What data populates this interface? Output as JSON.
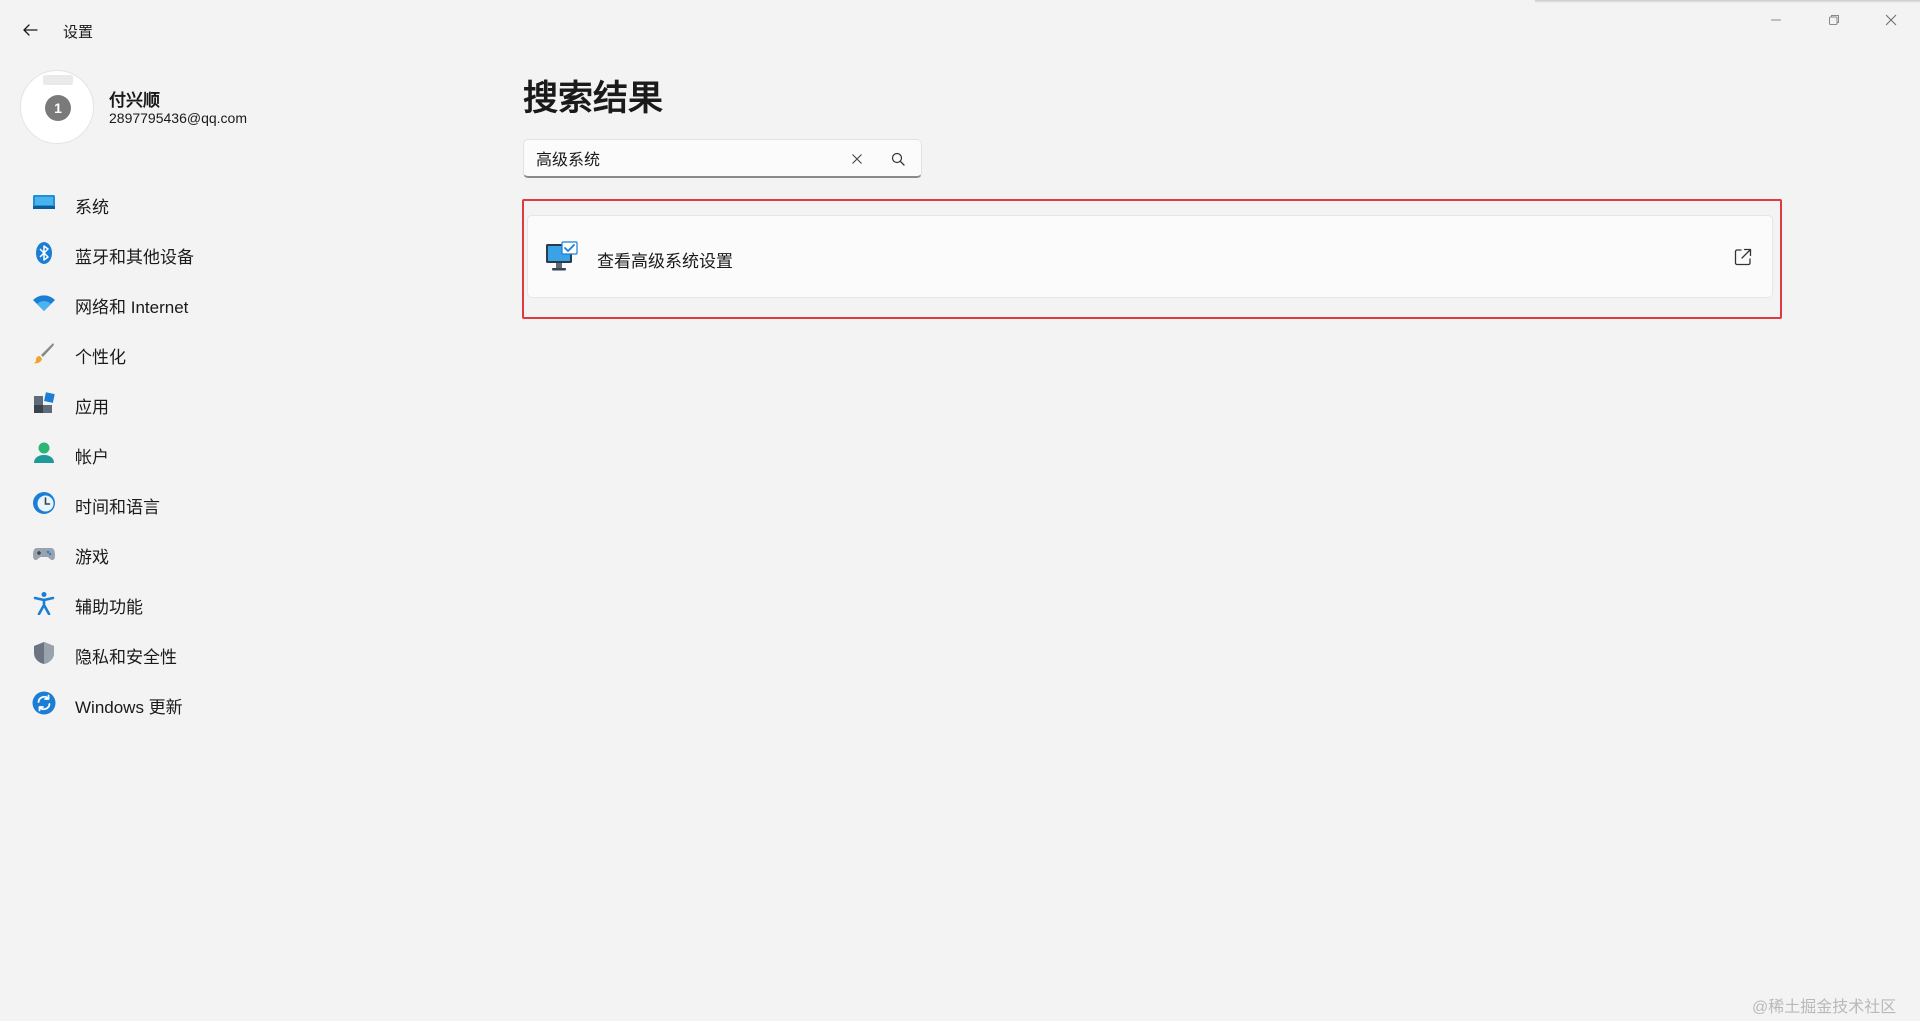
{
  "window": {
    "app_title": "设置"
  },
  "profile": {
    "name": "付兴顺",
    "email": "2897795436@qq.com",
    "avatar_badge": "1"
  },
  "sidebar": {
    "items": [
      {
        "label": "系统",
        "icon": "system-icon"
      },
      {
        "label": "蓝牙和其他设备",
        "icon": "bluetooth-icon"
      },
      {
        "label": "网络和 Internet",
        "icon": "wifi-icon"
      },
      {
        "label": "个性化",
        "icon": "brush-icon"
      },
      {
        "label": "应用",
        "icon": "apps-icon"
      },
      {
        "label": "帐户",
        "icon": "account-icon"
      },
      {
        "label": "时间和语言",
        "icon": "time-language-icon"
      },
      {
        "label": "游戏",
        "icon": "gamepad-icon"
      },
      {
        "label": "辅助功能",
        "icon": "accessibility-icon"
      },
      {
        "label": "隐私和安全性",
        "icon": "shield-icon"
      },
      {
        "label": "Windows 更新",
        "icon": "windows-update-icon"
      }
    ]
  },
  "main": {
    "title": "搜索结果",
    "search": {
      "value": "高级系统"
    },
    "results": [
      {
        "label": "查看高级系统设置",
        "icon": "monitor-check-icon",
        "action_icon": "open-external-icon"
      }
    ]
  },
  "watermark": "@稀土掘金技术社区",
  "colors": {
    "background": "#f3f3f3",
    "card": "#fbfbfb",
    "highlight": "#e0393f",
    "accent": "#0a78d4"
  }
}
